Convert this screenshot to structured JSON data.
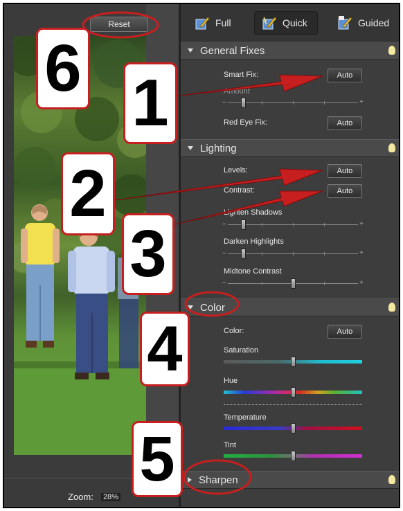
{
  "toolbar": {
    "reset_label": "Reset"
  },
  "mode_tabs": [
    {
      "label": "Full",
      "icon": "full-edit-icon"
    },
    {
      "label": "Quick",
      "icon": "quick-edit-icon",
      "active": true
    },
    {
      "label": "Guided",
      "icon": "guided-edit-icon"
    }
  ],
  "sections": {
    "general_fixes": {
      "title": "General Fixes",
      "smart_fix_label": "Smart Fix:",
      "smart_fix_button": "Auto",
      "smart_fix_slider_label": "Amount",
      "red_eye_label": "Red Eye Fix:",
      "red_eye_button": "Auto"
    },
    "lighting": {
      "title": "Lighting",
      "levels_label": "Levels:",
      "levels_button": "Auto",
      "contrast_label": "Contrast:",
      "contrast_button": "Auto",
      "lighten_shadows_label": "Lighten Shadows",
      "darken_highlights_label": "Darken Highlights",
      "midtone_contrast_label": "Midtone Contrast"
    },
    "color": {
      "title": "Color",
      "color_label": "Color:",
      "color_button": "Auto",
      "saturation_label": "Saturation",
      "hue_label": "Hue",
      "temperature_label": "Temperature",
      "tint_label": "Tint"
    },
    "sharpen": {
      "title": "Sharpen"
    }
  },
  "slider_values": {
    "amount": 0.1,
    "lighten_shadows": 0.1,
    "darken_highlights": 0.1,
    "midtone_contrast": 0.5,
    "saturation": 0.5,
    "hue": 0.5,
    "temperature": 0.5,
    "tint": 0.5
  },
  "status": {
    "zoom_label": "Zoom:",
    "zoom_value": "28%"
  },
  "callouts": [
    "1",
    "2",
    "3",
    "4",
    "5",
    "6"
  ],
  "colors": {
    "annotation_red": "#c71f1f",
    "panel_bg": "#3d3d3d",
    "header_bg": "#4a4a4a"
  }
}
